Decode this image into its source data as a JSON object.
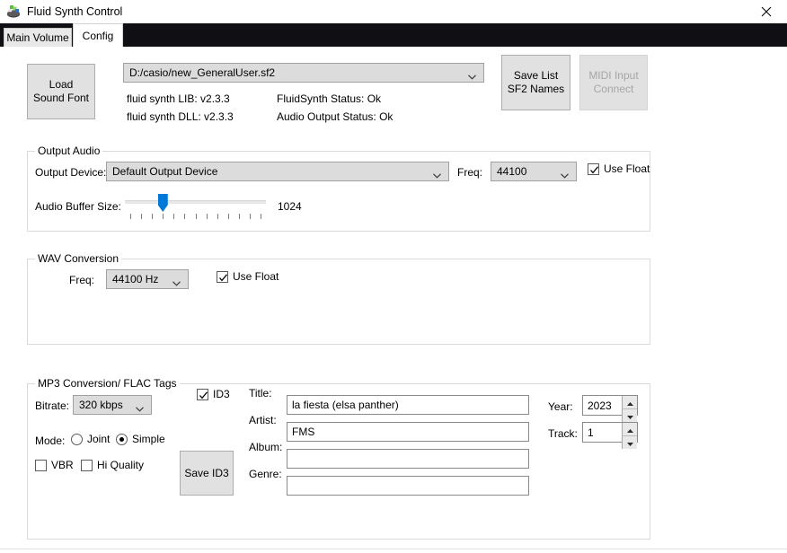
{
  "window": {
    "title": "Fluid Synth Control",
    "app_icon": "synth-app-icon",
    "close_icon": "close-icon"
  },
  "tabs": [
    {
      "label": "Main Volume",
      "active": false
    },
    {
      "label": "Config",
      "active": true
    }
  ],
  "colors": {
    "accent": "#0078d7",
    "tabstrip_background": "#101014",
    "window_background": "#ffffff",
    "button_face": "#e1e1e1",
    "combo_face": "#dcdcdc",
    "disabled_text": "#a6a6a6",
    "group_border": "#dadada"
  },
  "soundfont": {
    "load_button_label": "Load\nSound Font",
    "path_value": "D:/casio/new_GeneralUser.sf2",
    "path_placeholder": "",
    "chevron_icon": "chevron-down-icon",
    "info": [
      {
        "left": "fluid synth LIB: v2.3.3",
        "right": "FluidSynth Status: Ok"
      },
      {
        "left": "fluid synth DLL: v2.3.3",
        "right": "Audio Output Status: Ok"
      }
    ],
    "save_list_button_label": "Save List\nSF2 Names",
    "midi_input_button_label": "MIDI Input\nConnect",
    "midi_input_disabled": true
  },
  "output_audio": {
    "group_title": "Output Audio",
    "device_label": "Output Device:",
    "device_value": "Default Output Device",
    "freq_label": "Freq:",
    "freq_value": "44100",
    "use_float_label": "Use Float",
    "use_float_checked": true,
    "buffer_label": "Audio Buffer Size:",
    "buffer_value": "1024",
    "buffer_ticks": 13,
    "buffer_thumb_index": 3
  },
  "wav_conversion": {
    "group_title": "WAV Conversion",
    "freq_label": "Freq:",
    "freq_value": "44100 Hz",
    "use_float_label": "Use Float",
    "use_float_checked": true
  },
  "mp3_conversion": {
    "group_title": "MP3 Conversion/ FLAC Tags",
    "bitrate_label": "Bitrate:",
    "bitrate_value": "320 kbps",
    "mode_label": "Mode:",
    "mode_joint_label": "Joint",
    "mode_simple_label": "Simple",
    "mode_selected": "Simple",
    "vbr_label": "VBR",
    "vbr_checked": false,
    "hi_quality_label": "Hi Quality",
    "hi_quality_checked": false,
    "id3_label": "ID3",
    "id3_checked": true,
    "save_id3_button_label": "Save ID3",
    "fields": [
      {
        "label": "Title:",
        "value": "la fiesta (elsa panther)",
        "placeholder": ""
      },
      {
        "label": "Artist:",
        "value": "FMS",
        "placeholder": ""
      },
      {
        "label": "Album:",
        "value": "",
        "placeholder": ""
      },
      {
        "label": "Genre:",
        "value": "",
        "placeholder": ""
      }
    ],
    "year_label": "Year:",
    "year_value": "2023",
    "track_label": "Track:",
    "track_value": "1"
  }
}
